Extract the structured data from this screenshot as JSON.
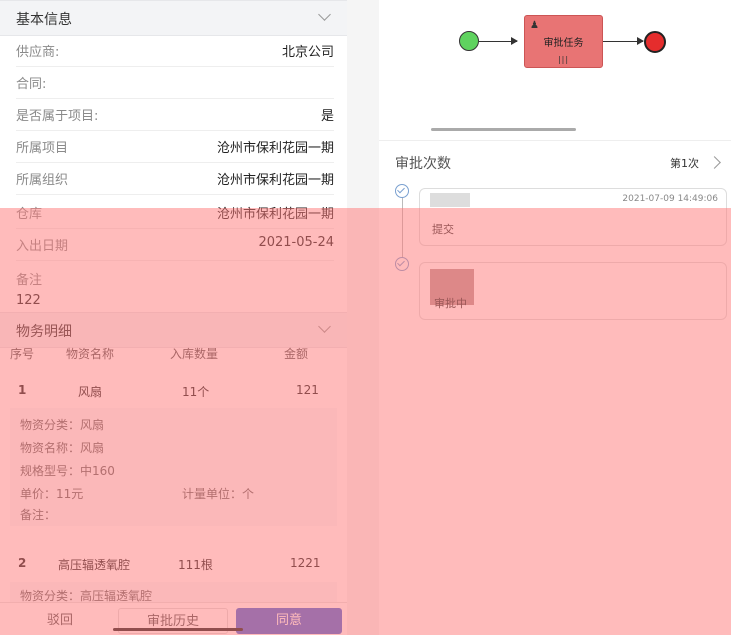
{
  "basic_info": {
    "title": "基本信息",
    "rows": [
      {
        "label": "供应商:",
        "value": "北京公司"
      },
      {
        "label": "合同:",
        "value": ""
      },
      {
        "label": "是否属于项目:",
        "value": "是"
      },
      {
        "label": "所属项目",
        "value": "沧州市保利花园一期"
      },
      {
        "label": "所属组织",
        "value": "沧州市保利花园一期"
      },
      {
        "label": "仓库",
        "value": "沧州市保利花园一期"
      },
      {
        "label": "入出日期",
        "value": "2021-05-24"
      }
    ],
    "remark_label": "备注",
    "remark_value": "122"
  },
  "goods_detail": {
    "title": "物务明细",
    "headers": [
      "序号",
      "物资名称",
      "入库数量",
      "金额"
    ],
    "items": [
      {
        "index": "1",
        "name": "风扇",
        "qty": "11个",
        "amount": "121",
        "details": {
          "category": "物资分类：风扇",
          "name": "物资名称：风扇",
          "spec": "规格型号：中160",
          "price": "单价：11元",
          "unit": "计量单位：个",
          "remark": "备注："
        }
      },
      {
        "index": "2",
        "name": "高压辐透氧腔",
        "qty": "111根",
        "amount": "1221",
        "details": {
          "category": "物资分类：高压辐透氧腔"
        }
      }
    ]
  },
  "actions": {
    "back": "驳回",
    "history": "审批历史",
    "agree": "同意"
  },
  "flow": {
    "task_label": "审批任务",
    "multi_mark": "|||"
  },
  "approval": {
    "title": "审批次数",
    "count": "第1次",
    "records": [
      {
        "time": "2021-07-09 14:49:06",
        "action": "提交"
      },
      {
        "time": "",
        "action": "审批中"
      }
    ]
  },
  "colors": {
    "task_fill": "#e87474",
    "start": "#5fd35f",
    "end": "#e52d2d",
    "primary": "#4a68d8"
  }
}
